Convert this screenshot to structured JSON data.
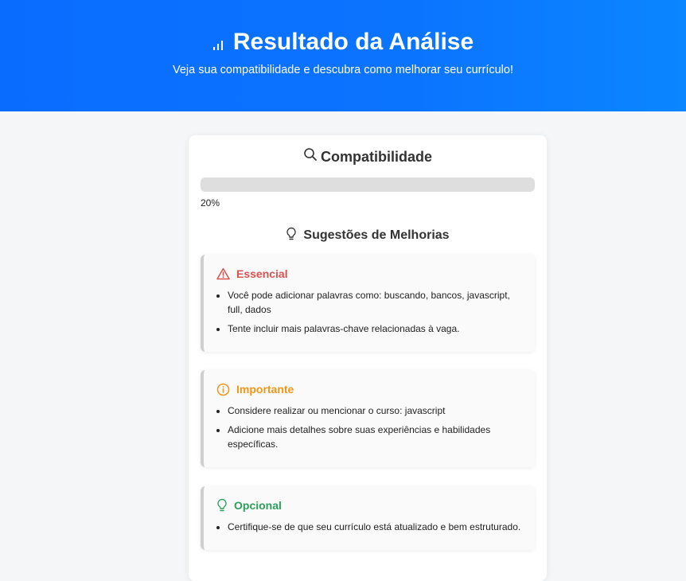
{
  "header": {
    "title": "Resultado da Análise",
    "subtitle": "Veja sua compatibilidade e descubra como melhorar seu currículo!",
    "icon": "chart-icon"
  },
  "compatibility": {
    "title": "Compatibilidade",
    "icon": "search-icon",
    "percent": 20,
    "percent_label": "20%"
  },
  "suggestions": {
    "title": "Sugestões de Melhorias",
    "icon": "lightbulb-icon",
    "groups": [
      {
        "label": "Essencial",
        "icon": "warning-icon",
        "color": "#d9534f",
        "items": [
          "Você pode adicionar palavras como: buscando, bancos, javascript, full, dados",
          "Tente incluir mais palavras-chave relacionadas à vaga."
        ]
      },
      {
        "label": "Importante",
        "icon": "info-icon",
        "color": "#f0961a",
        "items": [
          "Considere realizar ou mencionar o curso: javascript",
          "Adicione mais detalhes sobre suas experiências e habilidades específicas."
        ]
      },
      {
        "label": "Opcional",
        "icon": "lightbulb-icon",
        "color": "#2e9e5b",
        "items": [
          "Certifique-se de que seu currículo está atualizado e bem estruturado."
        ]
      }
    ]
  }
}
